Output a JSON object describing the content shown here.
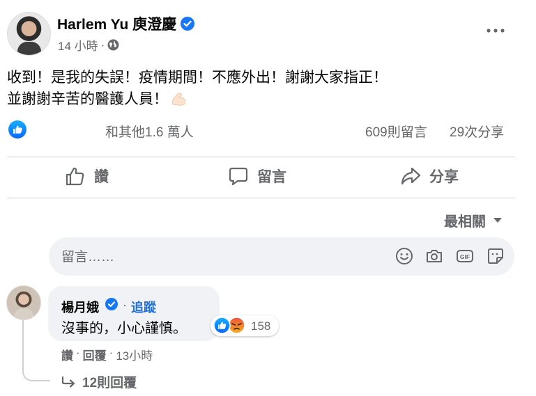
{
  "post": {
    "author": "Harlem Yu 庾澄慶",
    "time": "14 小時",
    "text_line1": "收到！是我的失誤！疫情期間！不應外出！謝謝大家指正！",
    "text_line2": "並謝謝辛苦的醫護人員！",
    "reactions_text": "和其他1.6 萬人",
    "comments_count": "609則留言",
    "shares_count": "29次分享"
  },
  "actions": {
    "like": "讚",
    "comment": "留言",
    "share": "分享"
  },
  "sort_label": "最相關",
  "comment_input": {
    "placeholder": "留言……"
  },
  "comment": {
    "author": "楊月娥",
    "dot": "·",
    "follow": "追蹤",
    "text": "沒事的，小心謹慎。",
    "reaction_count": "158",
    "like_label": "讚",
    "reply_label": "回覆",
    "time": "13小時",
    "replies": "12則回覆"
  },
  "colors": {
    "facebook_blue": "#1877f2",
    "secondary_text": "#65676b",
    "link_blue": "#216fdb"
  },
  "icons": [
    "verified-icon",
    "globe-icon",
    "more-icon",
    "like-reaction-icon",
    "flex-emoji-icon",
    "thumbs-up-icon",
    "comment-icon",
    "share-icon",
    "caret-down-icon",
    "emoji-icon",
    "camera-icon",
    "gif-icon",
    "sticker-icon",
    "angry-reaction-icon",
    "reply-arrow-icon"
  ]
}
